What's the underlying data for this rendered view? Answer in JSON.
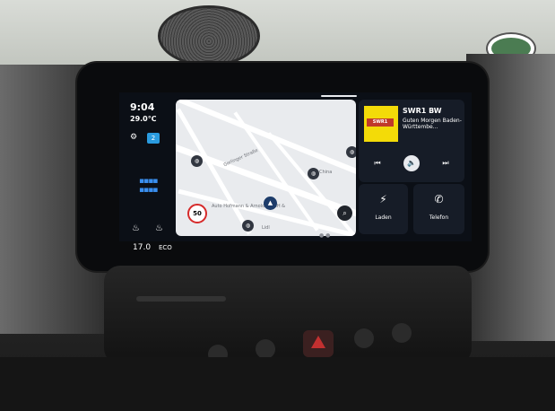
{
  "status": {
    "time": "9:04",
    "temperature": "29.0℃",
    "notification_count": "2",
    "climate_temperature": "17.0",
    "climate_mode": "ECO"
  },
  "map": {
    "speed_limit": "50",
    "labels": [
      "Gerlinger Straße",
      "China",
      "Auto Hofmann & Arnold GmbH &",
      "Lidl"
    ]
  },
  "media": {
    "station_name": "SWR1 BW",
    "station_logo_text": "SWR1",
    "now_playing": "Guten Morgen Baden-Württembe..."
  },
  "tiles": {
    "charging_label": "Laden",
    "phone_label": "Telefon"
  }
}
